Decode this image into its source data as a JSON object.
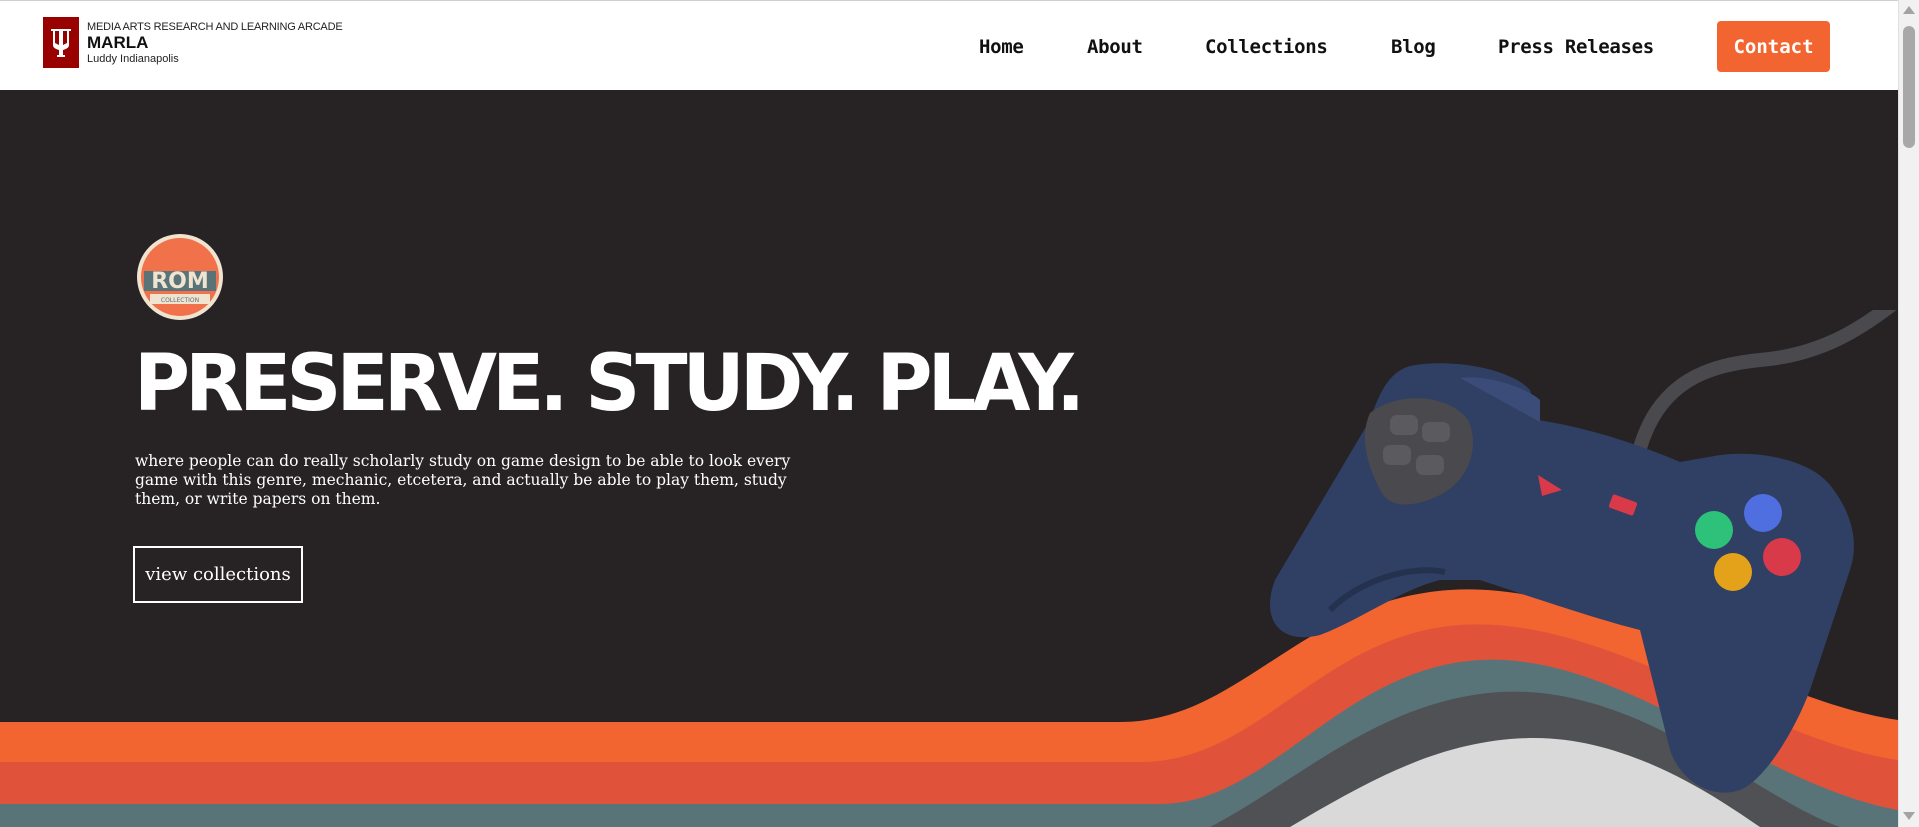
{
  "header": {
    "org_line": "MEDIA ARTS RESEARCH AND LEARNING ARCADE",
    "site_name": "MARLA",
    "sub_line": "Luddy Indianapolis",
    "logo_icon": "iu-trident-icon"
  },
  "nav": {
    "items": [
      {
        "label": "Home"
      },
      {
        "label": "About"
      },
      {
        "label": "Collections"
      },
      {
        "label": "Blog"
      },
      {
        "label": "Press Releases"
      }
    ],
    "contact_label": "Contact"
  },
  "hero": {
    "badge_text": "ROM",
    "badge_subtext": "COLLECTION",
    "headline": "PRESERVE. STUDY. PLAY.",
    "description": "where people can do really scholarly study on game design to be able to look every game with this genre, mechanic, etcetera, and actually be able to play them, study them, or write papers on them.",
    "cta_label": "view collections"
  },
  "colors": {
    "brand_red": "#990000",
    "accent_orange": "#f26531",
    "hero_bg": "#272324",
    "wave_orange": "#f26531",
    "wave_red": "#e0533a",
    "wave_teal": "#587479",
    "wave_gray": "#4f5155",
    "wave_light": "#d9d9d9",
    "controller_blue": "#303f64"
  }
}
